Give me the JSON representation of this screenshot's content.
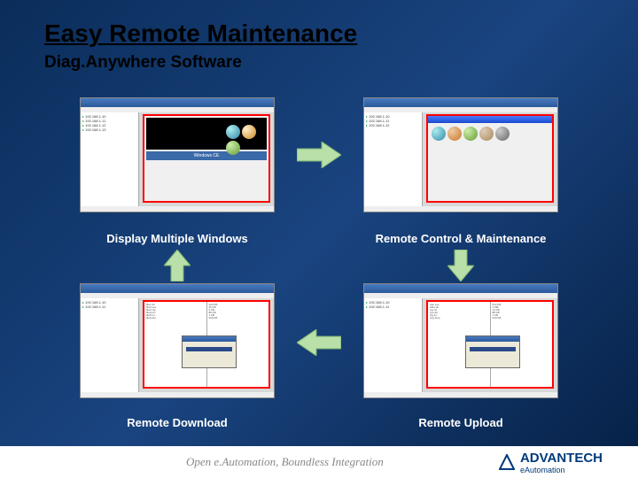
{
  "title": "Easy Remote Maintenance",
  "subtitle": "Diag.Anywhere Software",
  "captions": {
    "top_left": "Display Multiple Windows",
    "top_right": "Remote Control & Maintenance",
    "bottom_left": "Remote Download",
    "bottom_right": "Remote Upload"
  },
  "footer": {
    "tagline": "Open e.Automation, Boundless Integration",
    "logo": "ADVANTECH",
    "logo_sub": "eAutomation"
  }
}
